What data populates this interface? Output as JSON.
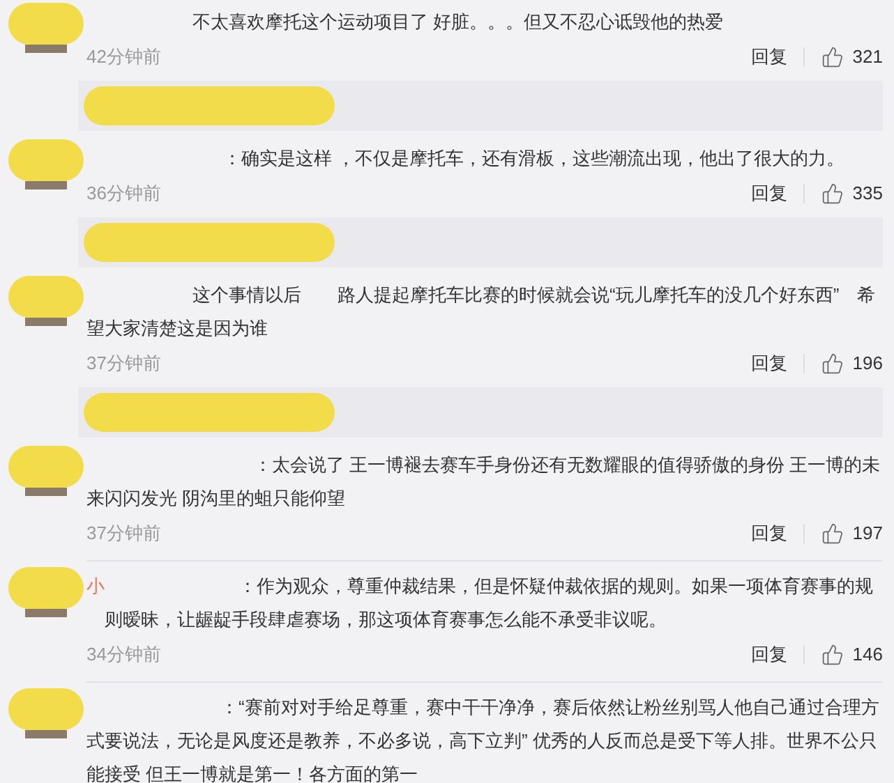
{
  "comments": [
    {
      "text": "不太喜欢摩托这个运动项目了 好脏。。。但又不忍心诋毁他的热爱",
      "time": "42分钟前",
      "reply": "回复",
      "likes": "321",
      "reply_preview": true,
      "divider_below": false
    },
    {
      "text": "：确实是这样 ，不仅是摩托车，还有滑板，这些潮流出现，他出了很大的力。",
      "time": "36分钟前",
      "reply": "回复",
      "likes": "335",
      "reply_preview": true,
      "divider_below": false
    },
    {
      "text": "这个事情以后　　路人提起摩托车比赛的时候就会说“玩儿摩托车的没几个好东西”　希望大家清楚这是因为谁",
      "time": "37分钟前",
      "reply": "回复",
      "likes": "196",
      "reply_preview": true,
      "divider_below": false
    },
    {
      "text": "：太会说了 王一博褪去赛车手身份还有无数耀眼的值得骄傲的身份 王一博的未来闪闪发光 阴沟里的蛆只能仰望",
      "time": "37分钟前",
      "reply": "回复",
      "likes": "197",
      "reply_preview": false,
      "divider_below": true
    },
    {
      "author": "小",
      "text": "：作为观众，尊重仲裁结果，但是怀疑仲裁依据的规则。如果一项体育赛事的规则暧昧，让龌龊手段肆虐赛场，那这项体育赛事怎么能不承受非议呢。",
      "time": "34分钟前",
      "reply": "回复",
      "likes": "146",
      "reply_preview": false,
      "divider_below": true
    },
    {
      "text": "：“赛前对对手给足尊重，赛中干干净净，赛后依然让粉丝别骂人他自己通过合理方式要说法，无论是风度还是教养，不必多说，高下立判” 优秀的人反而总是受下等人排。世界不公只能接受 但王一博就是第一！各方面的第一",
      "reply_preview": false,
      "divider_below": false
    }
  ]
}
